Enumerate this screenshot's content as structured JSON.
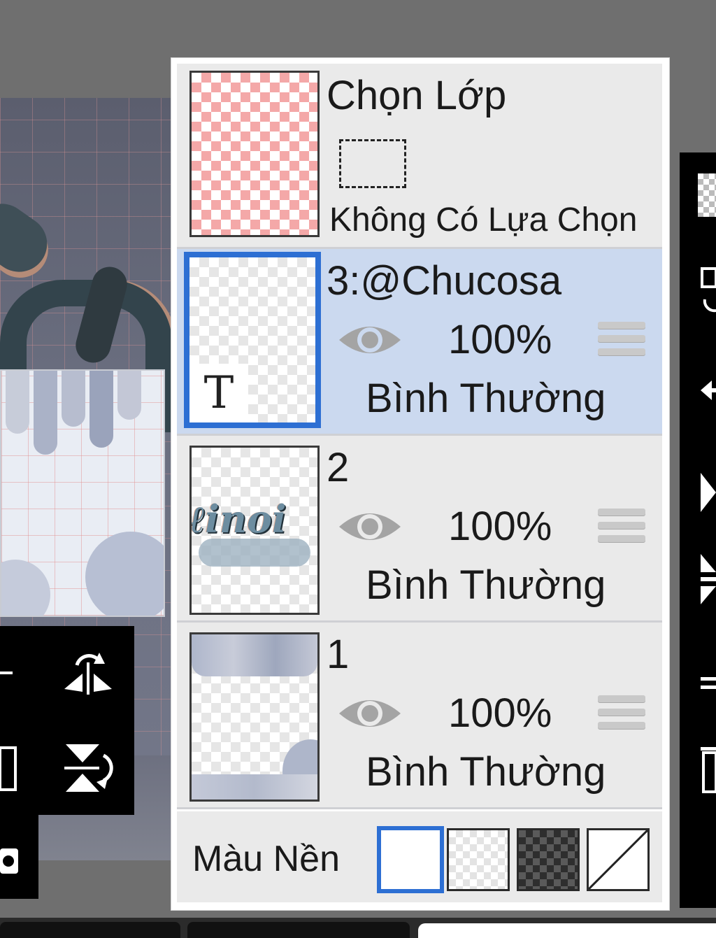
{
  "select_layer": {
    "title": "Chọn Lớp",
    "status": "Không Có Lựa Chọn"
  },
  "layers": [
    {
      "name": "3:@Chucosa",
      "opacity": "100%",
      "blend": "Bình Thường",
      "selected": true,
      "type_icon": "T"
    },
    {
      "name": "2",
      "opacity": "100%",
      "blend": "Bình Thường",
      "selected": false
    },
    {
      "name": "1",
      "opacity": "100%",
      "blend": "Bình Thường",
      "selected": false
    }
  ],
  "background": {
    "label": "Màu Nền",
    "options": [
      "white",
      "light-checker",
      "dark-checker",
      "transparent"
    ],
    "selected": "white"
  },
  "colors": {
    "selected_row": "#cbd9ef",
    "accent": "#2d6fd3",
    "row_bg": "#eaeaea"
  }
}
